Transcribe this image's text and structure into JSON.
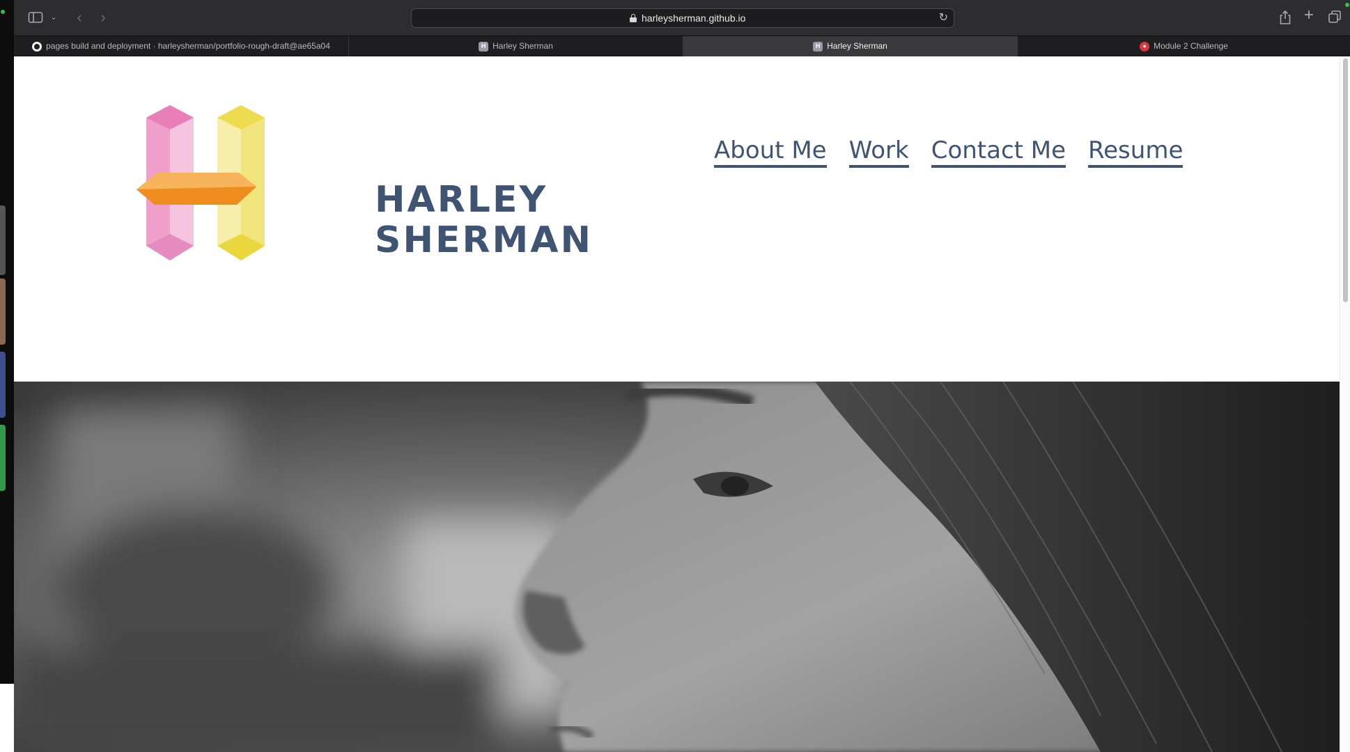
{
  "browser": {
    "url": "harleysherman.github.io",
    "tabs": [
      {
        "title": "pages build and deployment · harleysherman/portfolio-rough-draft@ae65a04",
        "icon": "github-icon",
        "active": false
      },
      {
        "title": "Harley Sherman",
        "icon": "h-favicon-icon",
        "active": false
      },
      {
        "title": "Harley Sherman",
        "icon": "h-favicon-icon",
        "active": true
      },
      {
        "title": "Module 2 Challenge",
        "icon": "module-favicon-icon",
        "active": false
      }
    ]
  },
  "site": {
    "logo": {
      "line1": "HARLEY",
      "line2": "SHERMAN"
    },
    "nav": [
      {
        "label": "About Me"
      },
      {
        "label": "Work"
      },
      {
        "label": "Contact Me"
      },
      {
        "label": "Resume"
      }
    ],
    "hero": {
      "image": "grayscale-portrait-profile"
    }
  },
  "colors": {
    "brand_text": "#3f5373",
    "crystal_pink": "#f2a7cf",
    "crystal_yellow": "#f2e27a",
    "crystal_orange": "#f39a2c",
    "toolbar_bg": "#2d2c2e",
    "tabbar_bg": "#1f1e20"
  }
}
